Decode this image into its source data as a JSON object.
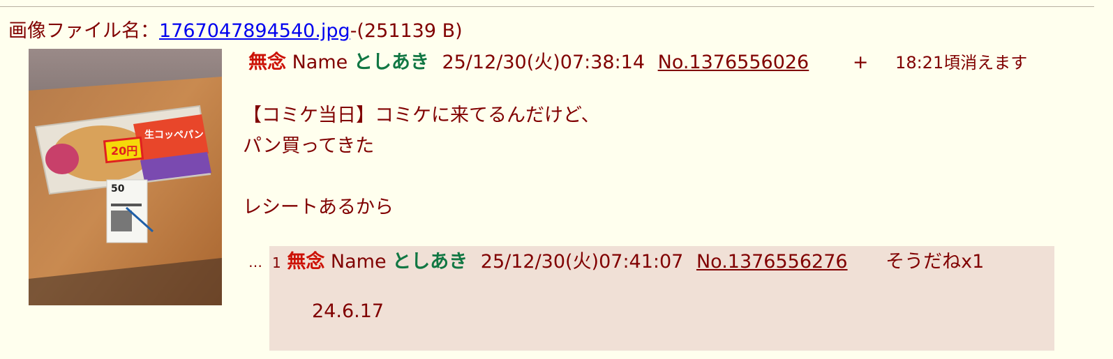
{
  "file": {
    "prefix": "画像ファイル名：",
    "filename": "1767047894540.jpg",
    "suffix": "-(251139 B)"
  },
  "op": {
    "subject": "無念",
    "name_label": "Name",
    "name": "としあき",
    "datetime": "25/12/30(火)07:38:14",
    "post_no": "No.1376556026",
    "plus": "+",
    "expire": "18:21頃消えます",
    "body_lines": [
      "【コミケ当日】コミケに来てるんだけど、",
      "パン買ってきた",
      "",
      "レシートあるから"
    ]
  },
  "reply": {
    "ellipsis": "…",
    "index": "1",
    "subject": "無念",
    "name_label": "Name",
    "name": "としあき",
    "datetime": "25/12/30(火)07:41:07",
    "post_no": "No.1376556276",
    "sodane": "そうだねx1",
    "body": "24.6.17"
  },
  "colors": {
    "background": "#ffffee",
    "text": "#800000",
    "subject": "#cc1105",
    "name": "#117743",
    "reply_background": "#f0e0d6",
    "link": "#0000ee"
  }
}
